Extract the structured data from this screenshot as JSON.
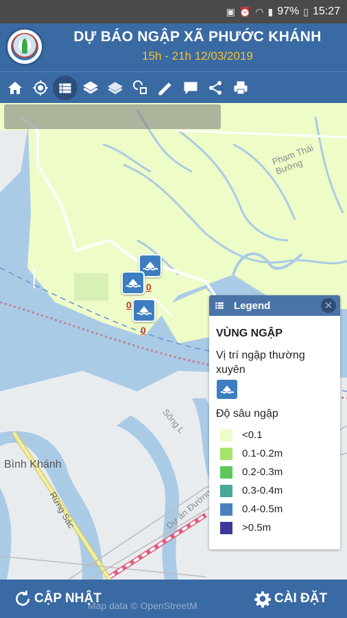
{
  "status_bar": {
    "battery": "97%",
    "time": "15:27"
  },
  "header": {
    "title": "DỰ BÁO NGẬP XÃ PHƯỚC KHÁNH",
    "subtitle": "15h - 21h 12/03/2019"
  },
  "toolbar": {
    "tools": [
      "home-icon",
      "locate-icon",
      "list-icon",
      "layers-icon",
      "layers-outline-icon",
      "identify-icon",
      "measure-icon",
      "comment-icon",
      "share-icon",
      "print-icon"
    ],
    "active": "list-icon"
  },
  "map": {
    "place_label": "Bình Khánh",
    "streets": {
      "pham_thai_buong": "Phạm Thái Bường",
      "song": "Sông L",
      "rung_sac": "Rừng Sác",
      "du_an_duong": "Dự án Đường D"
    },
    "marker_values": [
      "0",
      "0"
    ]
  },
  "legend": {
    "title": "Legend",
    "section": "VÙNG NGẬP",
    "frequent_label": "Vị trí ngập thường xuyên",
    "depth_label": "Độ sâu ngập",
    "rows": [
      {
        "label": "<0.1",
        "color": "#eefcc8"
      },
      {
        "label": "0.1-0.2m",
        "color": "#a6e36a"
      },
      {
        "label": "0.2-0.3m",
        "color": "#5cc85a"
      },
      {
        "label": "0.3-0.4m",
        "color": "#4aa89a"
      },
      {
        "label": "0.4-0.5m",
        "color": "#4a80c0"
      },
      {
        "label": ">0.5m",
        "color": "#3a3a9a"
      }
    ]
  },
  "bottom": {
    "update_label": "CẬP NHẬT",
    "settings_label": "CÀI ĐẶT",
    "attribution": "Map data © OpenStreetM"
  }
}
